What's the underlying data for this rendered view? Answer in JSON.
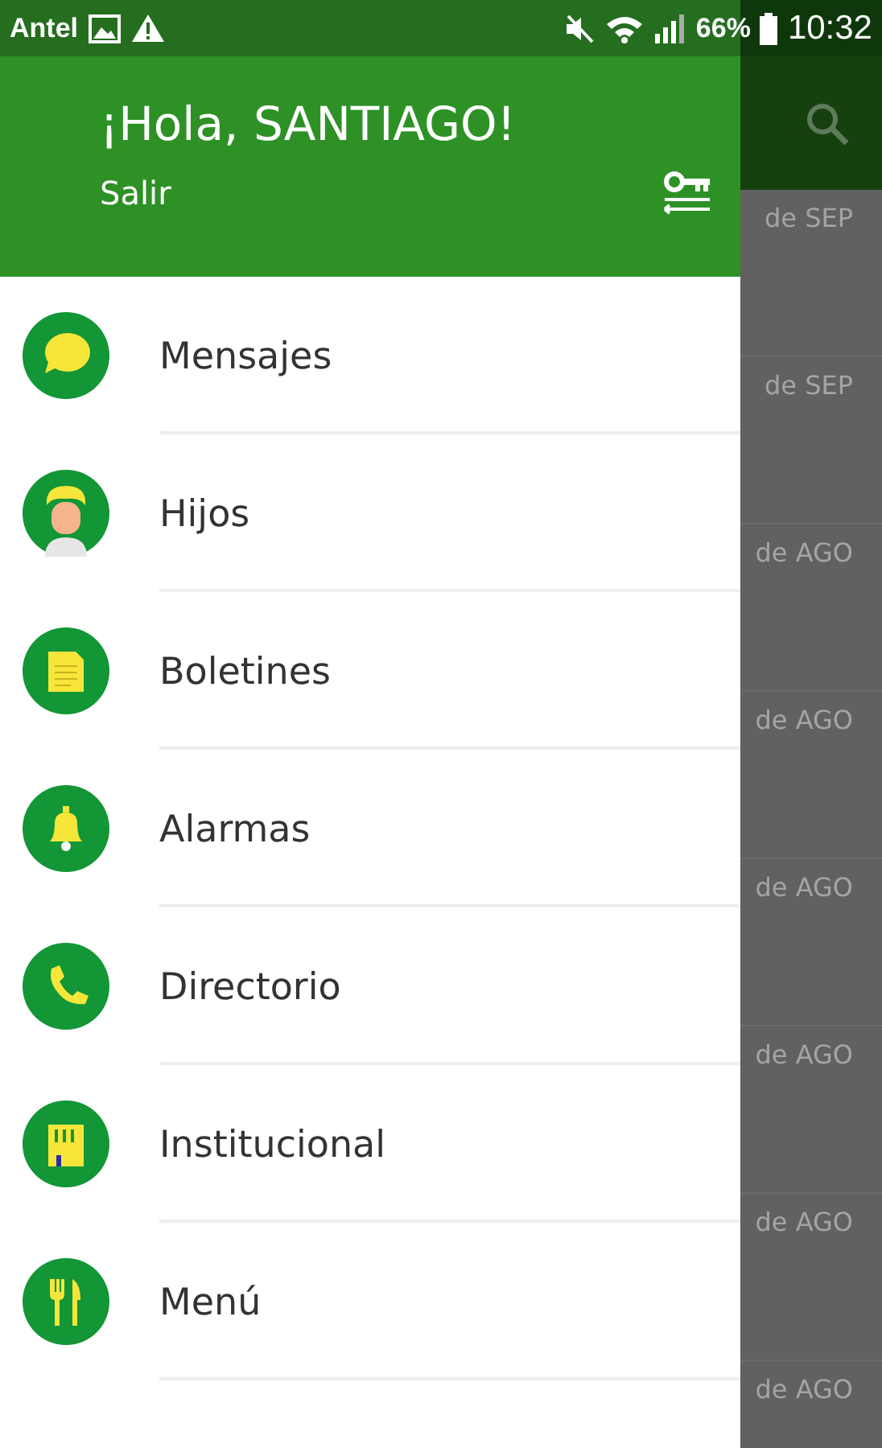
{
  "status_bar": {
    "carrier": "Antel",
    "battery": "66%",
    "time": "10:32"
  },
  "background": {
    "rows": [
      {
        "date": "de SEP"
      },
      {
        "date": "de SEP"
      },
      {
        "date": "de AGO"
      },
      {
        "date": "de AGO"
      },
      {
        "date": "de AGO"
      },
      {
        "date": "de AGO"
      },
      {
        "date": "de AGO"
      },
      {
        "date": "de AGO"
      }
    ]
  },
  "drawer": {
    "greeting": "¡Hola, SANTIAGO!",
    "logout": "Salir",
    "items": [
      {
        "label": "Mensajes",
        "kind": "chat"
      },
      {
        "label": "Hijos",
        "kind": "child"
      },
      {
        "label": "Boletines",
        "kind": "document"
      },
      {
        "label": "Alarmas",
        "kind": "bell"
      },
      {
        "label": "Directorio",
        "kind": "phone"
      },
      {
        "label": "Institucional",
        "kind": "building"
      },
      {
        "label": "Menú",
        "kind": "cutlery"
      }
    ]
  }
}
